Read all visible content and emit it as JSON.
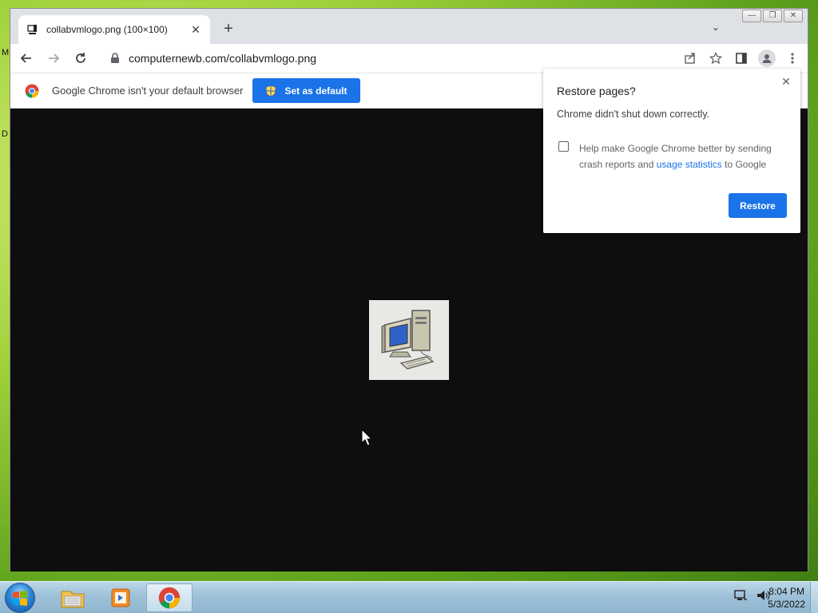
{
  "desktop": {
    "edge_labels": [
      "M",
      "D"
    ]
  },
  "window": {
    "controls": {
      "minimize": "—",
      "maximize": "❐",
      "close": "✕"
    }
  },
  "tabstrip": {
    "tab": {
      "title": "collabvmlogo.png (100×100)",
      "close": "✕"
    },
    "new_tab": "+",
    "tab_search": "⌄"
  },
  "toolbar": {
    "back": "←",
    "forward": "→",
    "reload": "↻",
    "url": "computernewb.com/collabvmlogo.png"
  },
  "infobar": {
    "text": "Google Chrome isn't your default browser",
    "button": "Set as default"
  },
  "popup": {
    "title": "Restore pages?",
    "message": "Chrome didn't shut down correctly.",
    "checkbox_checked": false,
    "checkbox_text_1": "Help make Google Chrome better by sending crash reports and",
    "checkbox_link": "usage statistics",
    "checkbox_text_2": "to Google",
    "restore_button": "Restore",
    "close": "✕"
  },
  "taskbar": {
    "time": "8:04 PM",
    "date": "5/3/2022"
  },
  "colors": {
    "accent": "#1a73e8",
    "content_bg": "#0e0e0e"
  }
}
